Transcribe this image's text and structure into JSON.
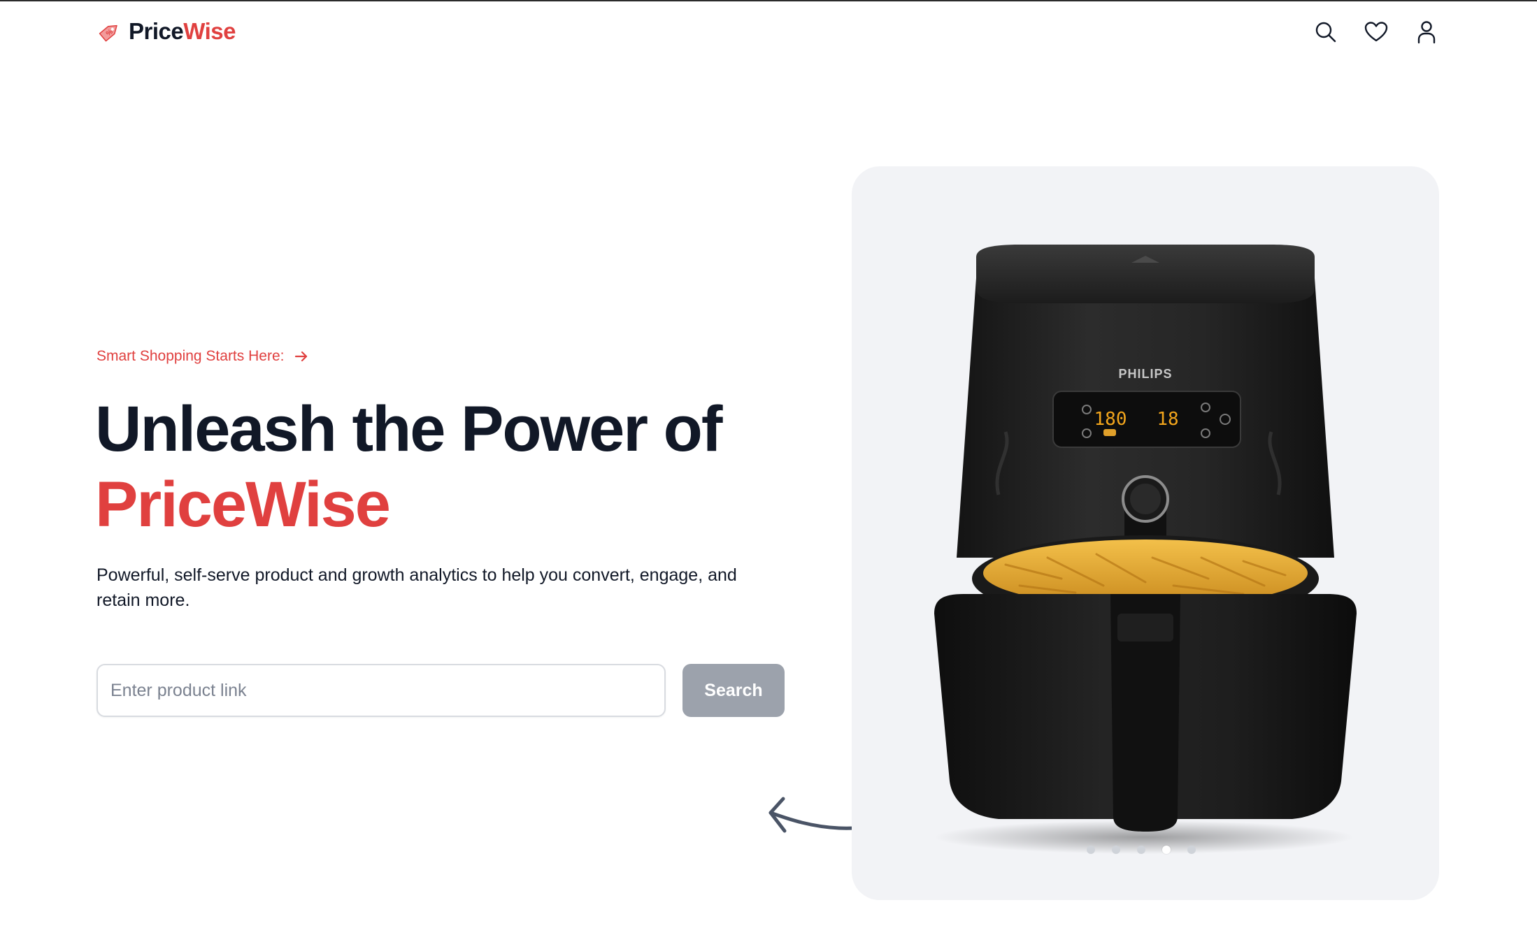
{
  "brand": {
    "name_part1": "Price",
    "name_part2": "Wise",
    "accent_color": "#e0403f",
    "text_color": "#111827"
  },
  "nav": {
    "icons": [
      "search-icon",
      "heart-icon",
      "user-icon"
    ]
  },
  "hero": {
    "tagline": "Smart Shopping Starts Here:",
    "headline_line1": "Unleash the Power of",
    "headline_line2": "PriceWise",
    "description": "Powerful, self-serve product and growth analytics to help you convert, engage, and retain more.",
    "search": {
      "placeholder": "Enter product link",
      "value": "",
      "button_label": "Search",
      "button_color": "#9ca2ac"
    }
  },
  "carousel": {
    "product_brand_text": "PHILIPS",
    "display_temp": "180",
    "display_time": "18",
    "slide_count": 5,
    "active_index": 3,
    "background": "#f2f3f6"
  }
}
